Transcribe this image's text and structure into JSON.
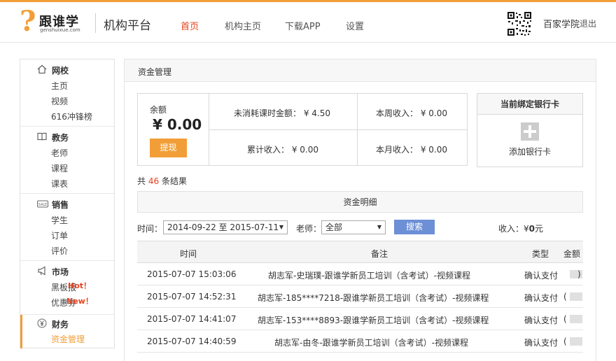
{
  "header": {
    "logo_text": "跟谁学",
    "logo_domain": "genshuixue.com",
    "platform_title": "机构平台",
    "nav": [
      {
        "label": "首页",
        "active": true
      },
      {
        "label": "机构主页",
        "active": false
      },
      {
        "label": "下载APP",
        "active": false
      },
      {
        "label": "设置",
        "active": false
      }
    ],
    "user_name": "百家学院",
    "logout_label": "退出"
  },
  "sidebar": {
    "sections": [
      {
        "title": "网校",
        "icon": "home-icon",
        "items": [
          "主页",
          "视频",
          "616冲锋榜"
        ]
      },
      {
        "title": "教务",
        "icon": "book-icon",
        "items": [
          "老师",
          "课程",
          "课表"
        ]
      },
      {
        "title": "销售",
        "icon": "sale-icon",
        "items": [
          "学生",
          "订单",
          "评价"
        ]
      },
      {
        "title": "市场",
        "icon": "megaphone-icon",
        "items": [
          "黑板报",
          "优惠券"
        ]
      },
      {
        "title": "财务",
        "icon": "yen-icon",
        "items": [
          "资金管理"
        ]
      }
    ],
    "badges": {
      "hot": "Hot！",
      "new": "New！"
    }
  },
  "main": {
    "title": "资金管理",
    "balance": {
      "label": "余额",
      "amount": "¥ 0.00",
      "withdraw_label": "提现",
      "unconsumed": "未消耗课时金额： ¥ 4.50",
      "week_income": "本周收入： ¥ 0.00",
      "total_income": "累计收入： ¥ 0.00",
      "month_income": "本月收入： ¥ 0.00"
    },
    "bank": {
      "title": "当前绑定银行卡",
      "add_label": "添加银行卡"
    },
    "result": {
      "prefix": "共",
      "count": "46",
      "suffix": "条结果"
    },
    "detail_title": "资金明细",
    "filter": {
      "time_label": "时间：",
      "time_value": "2014-09-22 至 2015-07-11",
      "teacher_label": "老师：",
      "teacher_value": "全部",
      "search_label": "搜索",
      "income_prefix": "收入：¥",
      "income_value": "0",
      "income_suffix": "元"
    },
    "table": {
      "headers": [
        "时间",
        "备注",
        "类型",
        "金额"
      ],
      "rows": [
        {
          "time": "2015-07-07 15:03:06",
          "note": "胡志军-史瑞璞-跟谁学新员工培训（含考试）-视频课程",
          "type": "确认支付",
          "amount": ")"
        },
        {
          "time": "2015-07-07 14:52:31",
          "note": "胡志军-185****7218-跟谁学新员工培训（含考试）-视频课程",
          "type": "确认支付",
          "amount": "("
        },
        {
          "time": "2015-07-07 14:41:07",
          "note": "胡志军-153****8893-跟谁学新员工培训（含考试）-视频课程",
          "type": "确认支付",
          "amount": "("
        },
        {
          "time": "2015-07-07 14:40:59",
          "note": "胡志军-由冬-跟谁学新员工培训（含考试）-视频课程",
          "type": "确认支付",
          "amount": "("
        }
      ]
    }
  },
  "colors": {
    "accent": "#f29e38",
    "active_nav": "#e8411d",
    "search_button": "#6d8fd6"
  }
}
